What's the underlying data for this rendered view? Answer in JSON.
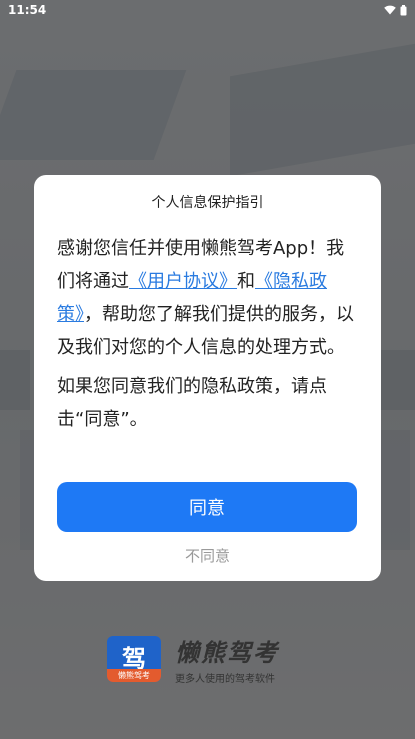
{
  "status_bar": {
    "time": "11:54",
    "wifi_icon": "wifi-icon",
    "battery_icon": "battery-icon"
  },
  "brand": {
    "logo_glyph": "驾",
    "logo_band": "懒熊驾考",
    "name": "懒熊驾考",
    "slogan": "更多人使用的驾考软件"
  },
  "dialog": {
    "title": "个人信息保护指引",
    "para1_intro": "感谢您信任并使用懒熊驾考App！我们将通过",
    "user_agreement_link": "《用户协议》",
    "and_text": "和",
    "privacy_policy_link": "《隐私政策》",
    "para1_rest": "，帮助您了解我们提供的服务，以及我们对您的个人信息的处理方式。",
    "para2": "如果您同意我们的隐私政策，请点击“同意”。",
    "agree_label": "同意",
    "disagree_label": "不同意"
  },
  "colors": {
    "primary": "#1e79f5",
    "link": "#2a7be0",
    "overlay": "rgba(0,0,0,0.55)"
  }
}
